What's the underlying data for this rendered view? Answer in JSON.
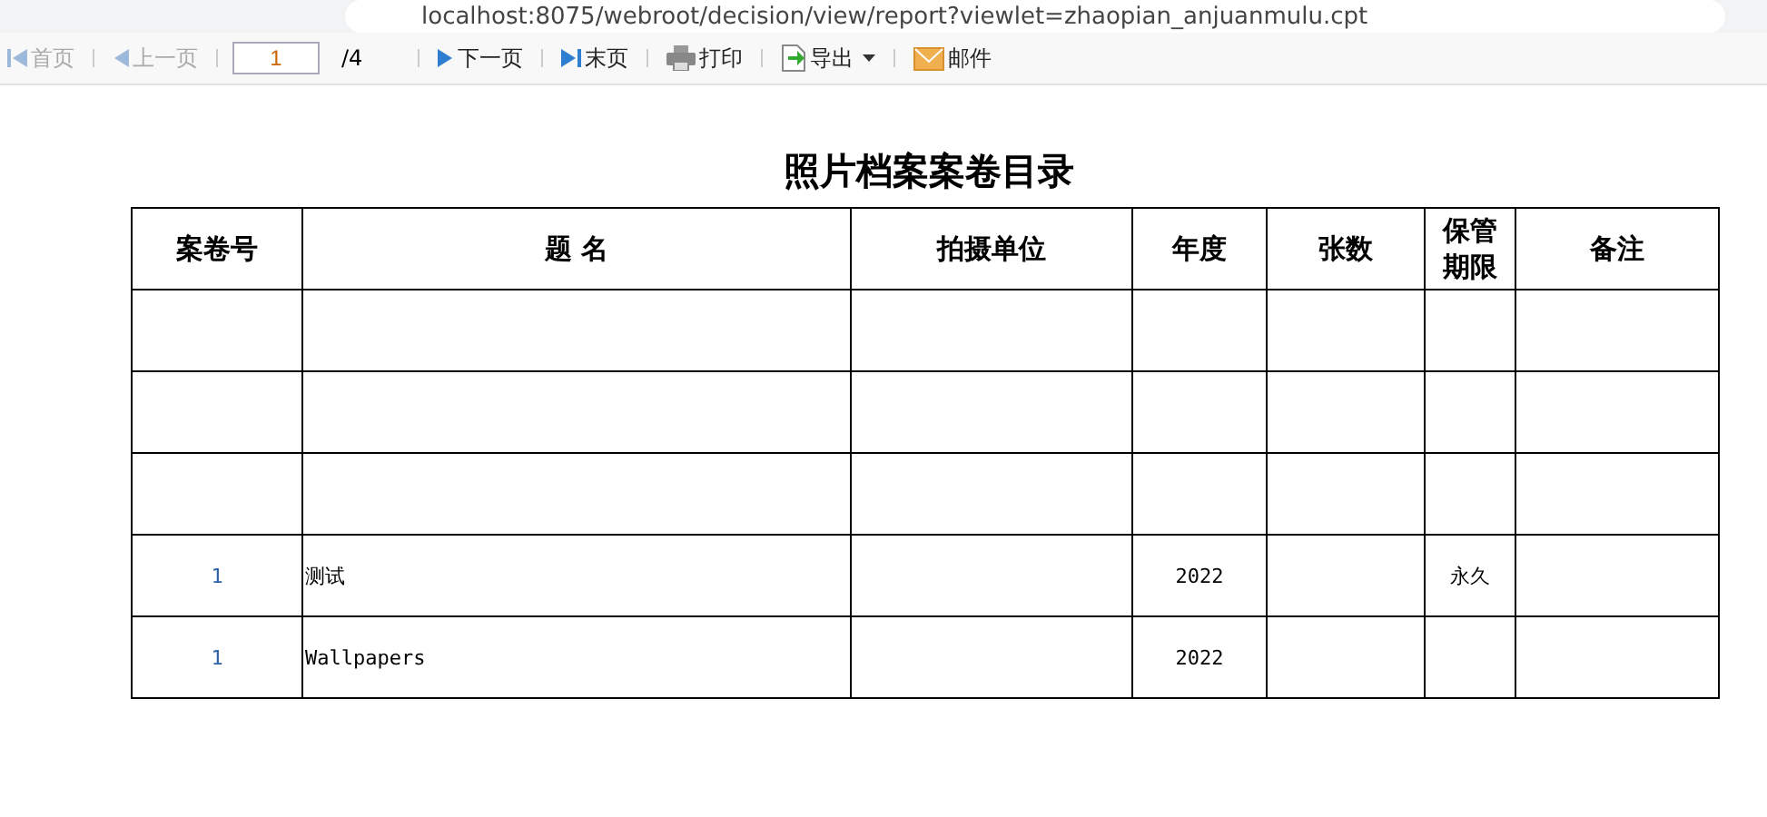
{
  "browser": {
    "url": "localhost:8075/webroot/decision/view/report?viewlet=zhaopian_anjuanmulu.cpt"
  },
  "toolbar": {
    "items": [
      {
        "kind": "first",
        "label": "首页",
        "disabled": true
      },
      {
        "kind": "prev",
        "label": "上一页",
        "disabled": true
      },
      {
        "kind": "page",
        "value": "1",
        "total": "/4"
      },
      {
        "kind": "next",
        "label": "下一页",
        "disabled": false
      },
      {
        "kind": "last",
        "label": "末页",
        "disabled": false
      },
      {
        "kind": "print",
        "label": "打印",
        "disabled": false
      },
      {
        "kind": "export",
        "label": "导出",
        "disabled": false
      },
      {
        "kind": "mail",
        "label": "邮件",
        "disabled": false
      }
    ]
  },
  "report": {
    "title": "照片档案案卷目录",
    "columns": [
      "案卷号",
      "题 名",
      "拍摄单位",
      "年度",
      "张数",
      "保管期限",
      "备注"
    ],
    "rows": [
      {},
      {},
      {},
      {
        "no": "1",
        "title": "测试",
        "year": "2022",
        "retention": "永久"
      },
      {
        "no": "1",
        "title": "Wallpapers",
        "year": "2022"
      }
    ]
  }
}
